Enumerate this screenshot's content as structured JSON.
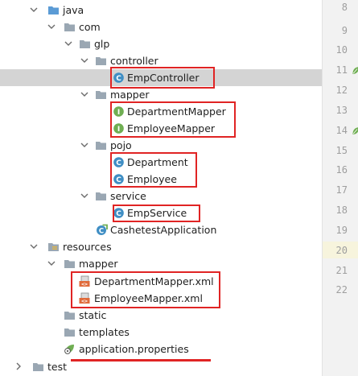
{
  "project_tree": {
    "java": "java",
    "com": "com",
    "glp": "glp",
    "controller": "controller",
    "emp_controller": "EmpController",
    "mapper": "mapper",
    "department_mapper": "DepartmentMapper",
    "employee_mapper": "EmployeeMapper",
    "pojo": "pojo",
    "department": "Department",
    "employee": "Employee",
    "service": "service",
    "emp_service": "EmpService",
    "app_class": "CashetestApplication",
    "resources": "resources",
    "res_mapper": "mapper",
    "department_mapper_xml": "DepartmentMapper.xml",
    "employee_mapper_xml": "EmployeeMapper.xml",
    "static": "static",
    "templates": "templates",
    "application_properties": "application.properties",
    "test": "test"
  },
  "gutter": {
    "line_numbers": [
      "8",
      "9",
      "10",
      "11",
      "12",
      "13",
      "14",
      "15",
      "16",
      "17",
      "18",
      "19",
      "20",
      "21",
      "22"
    ]
  },
  "colors": {
    "highlight_box": "#e02424",
    "class_icon": "#3f8ec4",
    "interface_icon": "#6fae52",
    "folder": "#9aa7b3",
    "selected_row": "#d4d4d4"
  },
  "icons": {
    "expand": "chevron-down-icon",
    "collapse": "chevron-right-icon",
    "folder": "folder-icon",
    "class": "class-icon",
    "interface": "interface-icon",
    "spring_boot_app": "spring-app-icon",
    "xml": "xml-file-icon",
    "properties": "properties-file-icon"
  }
}
